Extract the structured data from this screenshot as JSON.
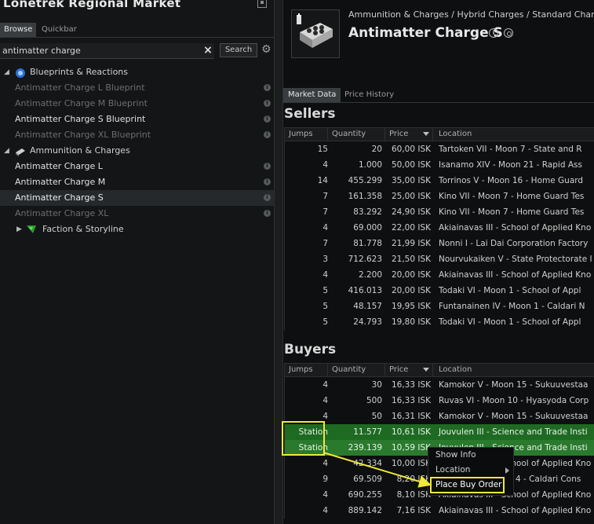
{
  "window": {
    "title": "Lonetrek Regional Market"
  },
  "left_tabs": [
    "Browse",
    "Quickbar"
  ],
  "search": {
    "value": "antimatter charge",
    "button_label": "Search"
  },
  "tree": [
    {
      "kind": "cat",
      "label": "Blueprints & Reactions",
      "icon": "blueprint-icon"
    },
    {
      "kind": "item",
      "label": "Antimatter Charge L Blueprint",
      "state": "dim"
    },
    {
      "kind": "item",
      "label": "Antimatter Charge M Blueprint",
      "state": "dim"
    },
    {
      "kind": "item",
      "label": "Antimatter Charge S Blueprint",
      "state": "bright"
    },
    {
      "kind": "item",
      "label": "Antimatter Charge XL Blueprint",
      "state": "dim"
    },
    {
      "kind": "cat",
      "label": "Ammunition & Charges",
      "icon": "ammo-icon"
    },
    {
      "kind": "item",
      "label": "Antimatter Charge L",
      "state": "bright"
    },
    {
      "kind": "item",
      "label": "Antimatter Charge M",
      "state": "bright"
    },
    {
      "kind": "item",
      "label": "Antimatter Charge S",
      "state": "selected"
    },
    {
      "kind": "item",
      "label": "Antimatter Charge XL",
      "state": "dim"
    },
    {
      "kind": "sub",
      "label": "Faction & Storyline",
      "icon": "faction-icon"
    }
  ],
  "item": {
    "breadcrumb": "Ammunition & Charges / Hybrid Charges / Standard Charg",
    "name": "Antimatter Charge S"
  },
  "right_tabs": [
    "Market Data",
    "Price History"
  ],
  "columns": {
    "jumps": "Jumps",
    "quantity": "Quantity",
    "price": "Price",
    "location": "Location"
  },
  "sellers": {
    "title": "Sellers",
    "rows": [
      {
        "jumps": "15",
        "quantity": "20",
        "price": "60,00 ISK",
        "location": "Tartoken VII - Moon 7 - State and R"
      },
      {
        "jumps": "4",
        "quantity": "1.000",
        "price": "50,00 ISK",
        "location": "Isanamo XIV - Moon 21 - Rapid Ass"
      },
      {
        "jumps": "14",
        "quantity": "455.299",
        "price": "35,00 ISK",
        "location": "Torrinos V - Moon 16 - Home Guard"
      },
      {
        "jumps": "7",
        "quantity": "161.358",
        "price": "25,00 ISK",
        "location": "Kino VII - Moon 7 - Home Guard Tes"
      },
      {
        "jumps": "7",
        "quantity": "83.292",
        "price": "24,90 ISK",
        "location": "Kino VII - Moon 7 - Home Guard Tes"
      },
      {
        "jumps": "4",
        "quantity": "69.000",
        "price": "22,00 ISK",
        "location": "Akiainavas III - School of Applied Kno"
      },
      {
        "jumps": "7",
        "quantity": "81.778",
        "price": "21,99 ISK",
        "location": "Nonni I - Lai Dai Corporation Factory"
      },
      {
        "jumps": "3",
        "quantity": "712.623",
        "price": "21,50 ISK",
        "location": "Nourvukaiken V - State Protectorate I"
      },
      {
        "jumps": "4",
        "quantity": "2.200",
        "price": "20,00 ISK",
        "location": "Akiainavas III - School of Applied Kno"
      },
      {
        "jumps": "5",
        "quantity": "416.013",
        "price": "20,00 ISK",
        "location": "Todaki VI - Moon 1 - School of Appl"
      },
      {
        "jumps": "5",
        "quantity": "48.157",
        "price": "19,95 ISK",
        "location": "Funtanainen IV - Moon 1 - Caldari N"
      },
      {
        "jumps": "5",
        "quantity": "24.793",
        "price": "19,80 ISK",
        "location": "Todaki VI - Moon 1 - School of Appl"
      }
    ]
  },
  "buyers": {
    "title": "Buyers",
    "rows": [
      {
        "jumps": "4",
        "quantity": "30",
        "price": "16,33 ISK",
        "location": "Kamokor V - Moon 15 - Sukuuvestaa",
        "hl": ""
      },
      {
        "jumps": "4",
        "quantity": "500",
        "price": "16,33 ISK",
        "location": "Ruvas VI - Moon 10 - Hyasyoda Corp",
        "hl": ""
      },
      {
        "jumps": "4",
        "quantity": "50",
        "price": "16,31 ISK",
        "location": "Kamokor V - Moon 15 - Sukuuvestaa",
        "hl": ""
      },
      {
        "jumps": "Station",
        "quantity": "11.577",
        "price": "10,61 ISK",
        "location": "Jouvulen III - Science and Trade Insti",
        "hl": "green"
      },
      {
        "jumps": "Station",
        "quantity": "239.139",
        "price": "10,59 ISK",
        "location": "Jouvulen III - Science and Trade Insti",
        "hl": "green2"
      },
      {
        "jumps": "4",
        "quantity": "42.334",
        "price": "10,00 ISK",
        "location": "Akiainavas III - School of Applied Kno",
        "hl": ""
      },
      {
        "jumps": "9",
        "quantity": "69.509",
        "price": "8,20 ISK",
        "location": "Jouvulen V - Moon 4 - Caldari Cons",
        "hl": ""
      },
      {
        "jumps": "4",
        "quantity": "690.255",
        "price": "8,10 ISK",
        "location": "Akiainavas III - School of Applied Kno",
        "hl": ""
      },
      {
        "jumps": "4",
        "quantity": "889.142",
        "price": "7,16 ISK",
        "location": "Akiainavas III - School of Applied Kno",
        "hl": ""
      }
    ]
  },
  "context_menu": {
    "items": [
      "Show Info",
      "Location",
      "Place Buy Order"
    ]
  },
  "colors": {
    "station_row": "#1e6a22",
    "annotation": "#f0e83a"
  }
}
